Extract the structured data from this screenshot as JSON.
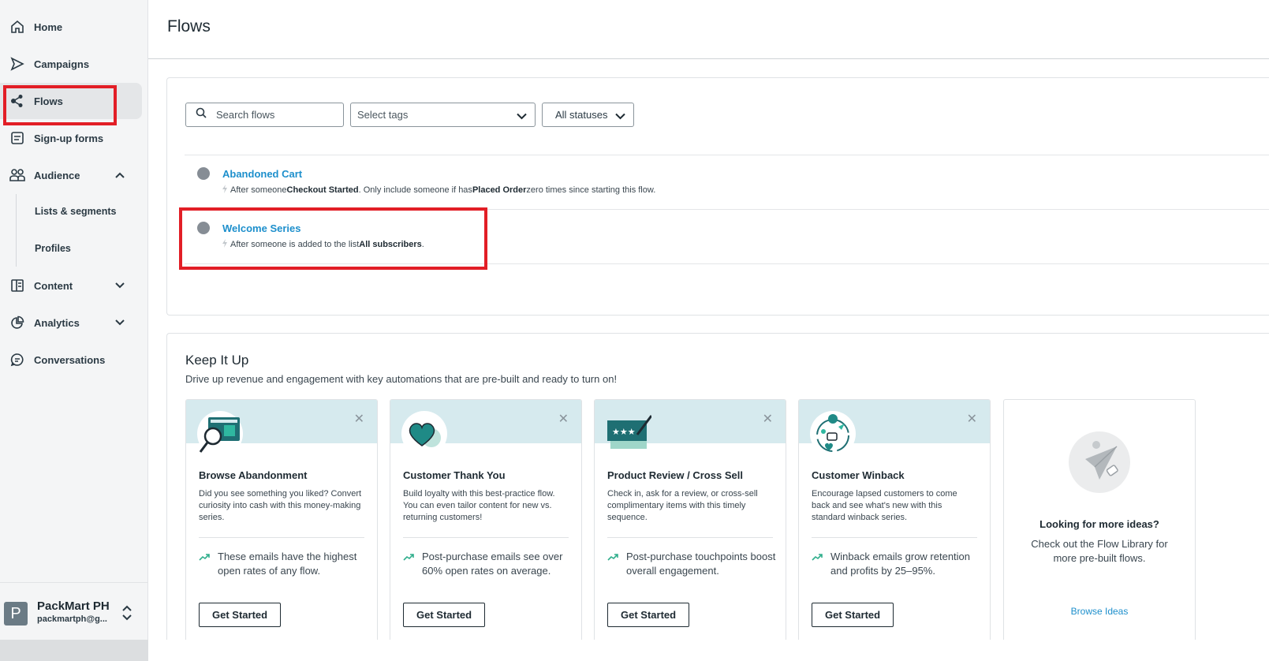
{
  "sidebar": {
    "items": [
      {
        "label": "Home",
        "icon": "home-icon"
      },
      {
        "label": "Campaigns",
        "icon": "send-icon"
      },
      {
        "label": "Flows",
        "icon": "flows-icon"
      },
      {
        "label": "Sign-up forms",
        "icon": "form-icon"
      },
      {
        "label": "Audience",
        "icon": "audience-icon"
      },
      {
        "label": "Content",
        "icon": "content-icon"
      },
      {
        "label": "Analytics",
        "icon": "analytics-icon"
      },
      {
        "label": "Conversations",
        "icon": "chat-icon"
      }
    ],
    "audience_sub": [
      "Lists & segments",
      "Profiles"
    ],
    "active": "Flows"
  },
  "account": {
    "initial": "P",
    "name": "PackMart PH",
    "email": "packmartph@g..."
  },
  "page": {
    "title": "Flows"
  },
  "filters": {
    "search_placeholder": "Search flows",
    "tags_placeholder": "Select tags",
    "status": "All statuses"
  },
  "flows": [
    {
      "name": "Abandoned Cart",
      "desc_pre": "After someone ",
      "desc_bold1": "Checkout Started",
      "desc_mid": ". Only include someone if has ",
      "desc_bold2": "Placed Order",
      "desc_post": " zero times since starting this flow."
    },
    {
      "name": "Welcome Series",
      "desc_pre": "After someone is added to the list ",
      "desc_bold1": "All subscribers",
      "desc_post": "."
    }
  ],
  "keep_it_up": {
    "title": "Keep It Up",
    "subtitle": "Drive up revenue and engagement with key automations that are pre-built and ready to turn on!",
    "cards": [
      {
        "title": "Browse Abandonment",
        "desc": "Did you see something you liked? Convert curiosity into cash with this money-making series.",
        "stat": "These emails have the highest open rates of any flow.",
        "button": "Get Started",
        "icon": "browse-magnifier-icon"
      },
      {
        "title": "Customer Thank You",
        "desc": "Build loyalty with this best-practice flow. You can even tailor content for new vs. returning customers!",
        "stat": "Post-purchase emails see over 60% open rates on average.",
        "button": "Get Started",
        "icon": "heart-icon"
      },
      {
        "title": "Product Review / Cross Sell",
        "desc": "Check in, ask for a review, or cross-sell complimentary items with this timely sequence.",
        "stat": "Post-purchase touchpoints boost overall engagement.",
        "button": "Get Started",
        "icon": "review-stars-icon"
      },
      {
        "title": "Customer Winback",
        "desc": "Encourage lapsed customers to come back and see what's new with this standard winback series.",
        "stat": "Winback emails grow retention and profits by 25–95%.",
        "button": "Get Started",
        "icon": "winback-cycle-icon"
      }
    ],
    "more": {
      "title": "Looking for more ideas?",
      "desc": "Check out the Flow Library for more pre-built flows.",
      "link": "Browse Ideas"
    }
  },
  "colors": {
    "accent": "#1d8fcc",
    "highlight": "#e21e26",
    "band": "#d6eaee",
    "teal": "#1f6f73"
  }
}
